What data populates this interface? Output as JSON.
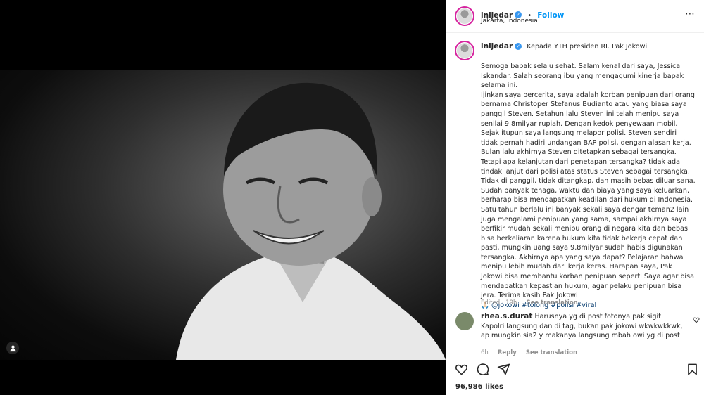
{
  "post": {
    "username": "inijedar",
    "follow_label": "Follow",
    "location": "Jakarta, Indonesia",
    "caption_first_line": "Kepada YTH presiden RI. Pak Jokowi",
    "caption_body": "Semoga bapak selalu sehat. Salam kenal dari saya, Jessica Iskandar. Salah seorang ibu yang mengagumi kinerja bapak selama ini.\nIjinkan saya bercerita, saya adalah korban penipuan dari orang bernama Christoper Stefanus Budianto atau yang biasa saya panggil Steven. Setahun lalu Steven ini telah menipu saya senilai 9.8milyar rupiah. Dengan kedok penyewaan mobil. Sejak itupun saya langsung melapor polisi. Steven sendiri tidak pernah hadiri undangan BAP polisi, dengan alasan kerja. Bulan lalu akhirnya Steven ditetapkan sebagai tersangka. Tetapi apa kelanjutan dari penetapan tersangka? tidak ada tindak lanjut dari polisi atas status Steven sebagai tersangka. Tidak di panggil, tidak ditangkap, dan masih bebas diluar sana. Sudah banyak tenaga, waktu dan biaya yang saya keluarkan, berharap bisa mendapatkan keadilan dari hukum di Indonesia. Satu tahun berlalu ini banyak sekali saya dengar teman2 lain juga mengalami penipuan yang sama, sampai akhirnya saya berfikir mudah sekali menipu orang di negara kita dan bebas bisa berkeliaran karena hukum kita tidak bekerja cepat dan pasti, mungkin uang saya 9.8milyar sudah habis digunakan tersangka. Akhirnya apa yang saya dapat? Pelajaran bahwa menipu lebih mudah dari kerja keras. Harapan saya, Pak Jokowi bisa membantu korban penipuan seperti Saya agar bisa mendapatkan kepastian hukum, agar pelaku penipuan bisa jera. Terima kasih Pak Jokowi",
    "emoji": "🙏🏻",
    "tags": "@jokowi #tolong #polisi #viral",
    "edited_time": "Edited · 19h",
    "see_translation": "See translation",
    "likes": "96,986 likes"
  },
  "comment": {
    "username": "rhea.s.durat",
    "text": "Harusnya yg di post fotonya pak sigit Kapolri langsung dan di tag, bukan pak jokowi wkwkwkkwk, ap mungkin sia2 y makanya langsung mbah owi yg di post",
    "time": "6h",
    "reply": "Reply",
    "see_translation": "See translation"
  },
  "icons": {
    "verified": "verified-badge-icon",
    "heart": "heart-icon",
    "comment": "comment-icon",
    "share": "share-icon",
    "save": "bookmark-icon",
    "tag": "user-tag-icon",
    "like_comment": "small-heart-icon"
  },
  "colors": {
    "link": "#0095f6",
    "verified": "#3897f0",
    "hashtag": "#00376b"
  }
}
